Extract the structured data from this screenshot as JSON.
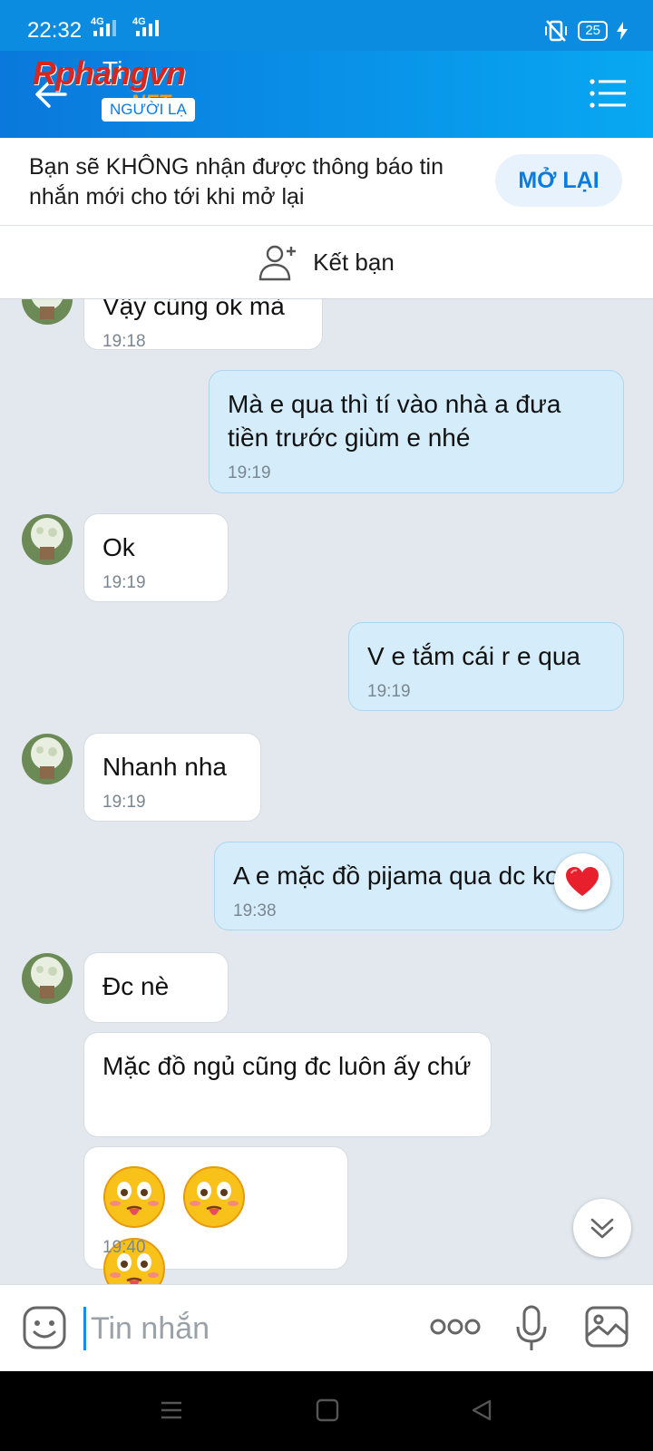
{
  "status_bar": {
    "time": "22:32",
    "signal_1": "4G",
    "signal_2": "4G",
    "battery": "25"
  },
  "header": {
    "contact_name": "Ti",
    "stranger_badge": "NGƯỜI LẠ",
    "watermark": "Rphangvn",
    "watermark_suffix": ".NET"
  },
  "notice": {
    "text": "Bạn sẽ KHÔNG nhận được thông báo tin nhắn mới cho tới khi mở lại",
    "button": "MỞ LẠI"
  },
  "add_friend": {
    "label": "Kết bạn"
  },
  "messages": [
    {
      "side": "in",
      "text": "Vậy cũng ok mà",
      "time": "19:18"
    },
    {
      "side": "out",
      "text": "Mà e qua thì tí vào nhà a đưa tiền trước giùm e nhé",
      "time": "19:19"
    },
    {
      "side": "in",
      "text": "Ok",
      "time": "19:19"
    },
    {
      "side": "out",
      "text": "V e tắm cái r e qua",
      "time": "19:19"
    },
    {
      "side": "in",
      "text": "Nhanh nha",
      "time": "19:19"
    },
    {
      "side": "out",
      "text": "A e mặc đồ pijama qua dc ko",
      "time": "19:38",
      "reaction": "heart-icon"
    },
    {
      "side": "in",
      "text": "Đc nè",
      "time": ""
    },
    {
      "side": "in",
      "text": "Mặc đồ ngủ cũng đc luôn ấy chứ",
      "time": ""
    },
    {
      "side": "in",
      "emojis": [
        "drooling-face-icon",
        "drooling-face-icon",
        "drooling-face-icon"
      ],
      "time": "19:40"
    }
  ],
  "composer": {
    "placeholder": "Tin nhắn"
  },
  "colors": {
    "brand_blue": "#0a7ce0",
    "outgoing_bubble": "#d5edfb",
    "chat_background": "#e2e8ee"
  }
}
